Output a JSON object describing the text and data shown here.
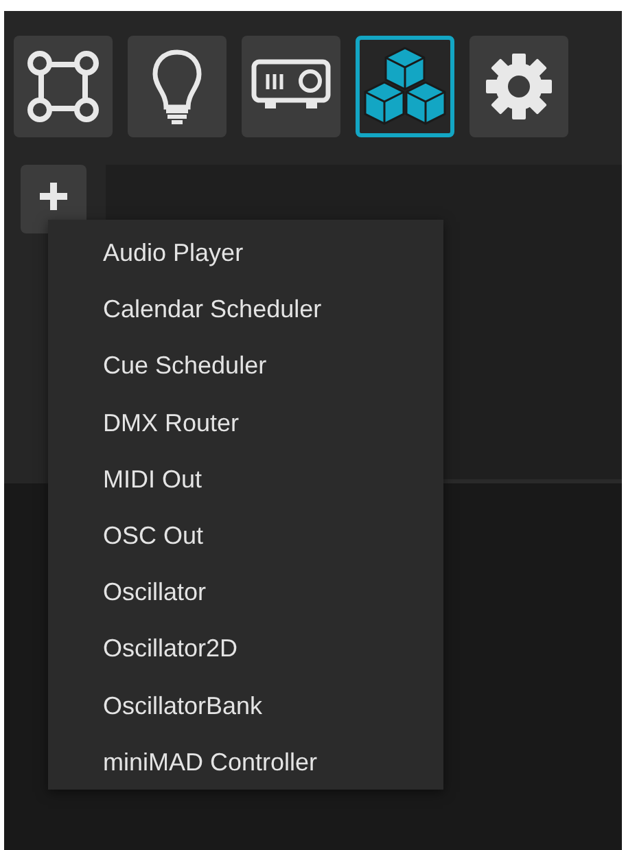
{
  "toolbar": [
    {
      "kind": "mapping",
      "selected": false
    },
    {
      "kind": "bulb",
      "selected": false
    },
    {
      "kind": "projector",
      "selected": false
    },
    {
      "kind": "modules",
      "selected": true
    },
    {
      "kind": "settings",
      "selected": false
    }
  ],
  "add_menu": {
    "items": [
      {
        "label": "Audio Player"
      },
      {
        "label": "Calendar Scheduler"
      },
      {
        "label": "Cue Scheduler"
      },
      {
        "label": "DMX Router"
      },
      {
        "label": "MIDI Out"
      },
      {
        "label": "OSC Out"
      },
      {
        "label": "Oscillator"
      },
      {
        "label": "Oscillator2D"
      },
      {
        "label": "OscillatorBank"
      },
      {
        "label": "miniMAD Controller"
      }
    ]
  }
}
